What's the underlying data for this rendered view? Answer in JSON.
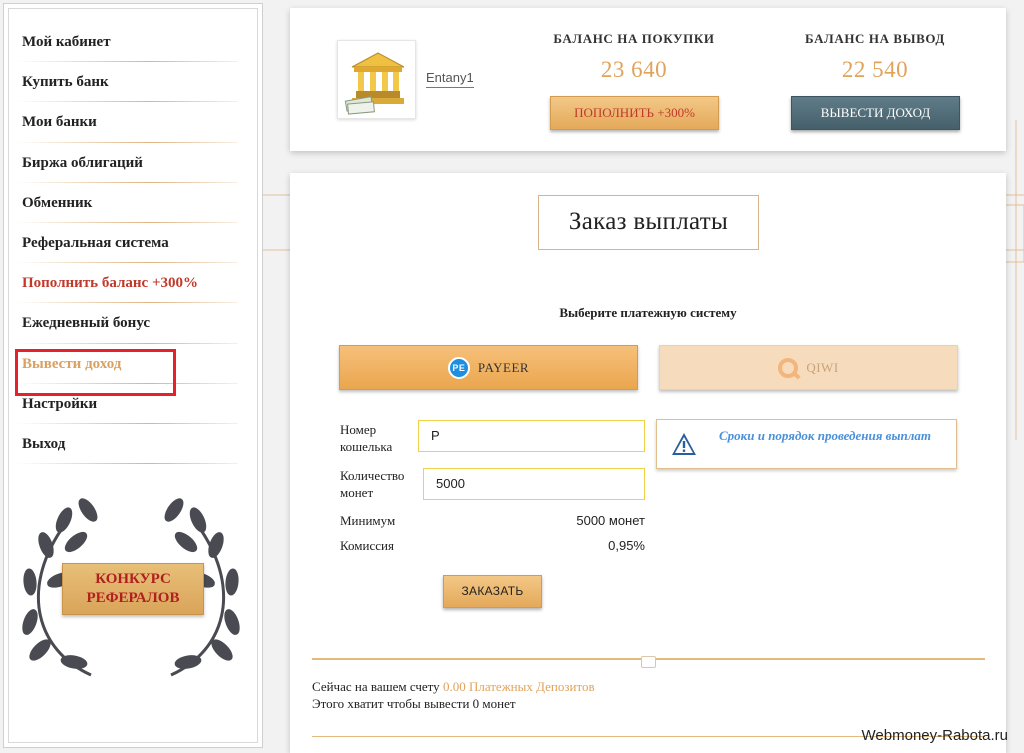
{
  "sidebar": {
    "items": [
      {
        "label": "Мой кабинет"
      },
      {
        "label": "Купить банк"
      },
      {
        "label": "Мои банки"
      },
      {
        "label": "Биржа облигаций"
      },
      {
        "label": "Обменник"
      },
      {
        "label": "Реферальная система"
      },
      {
        "label": "Пополнить баланс +300%"
      },
      {
        "label": "Ежедневный бонус"
      },
      {
        "label": "Вывести доход"
      },
      {
        "label": "Настройки"
      },
      {
        "label": "Выход"
      }
    ],
    "contest_line1": "КОНКУРС",
    "contest_line2": "РЕФЕРАЛОВ",
    "accent_color": "#c0392b",
    "active_color": "#d9a060",
    "highlight_frame_color": "#e8202a"
  },
  "header": {
    "username": "Entany1",
    "avatar_icon": "bank-building-icon",
    "purchase_balance_title": "БАЛАНС НА ПОКУПКИ",
    "purchase_balance_value": "23 640",
    "withdraw_balance_title": "БАЛАНС НА ВЫВОД",
    "withdraw_balance_value": "22 540",
    "topup_label": "ПОПОЛНИТЬ +300%",
    "withdraw_label": "ВЫВЕСТИ ДОХОД"
  },
  "main": {
    "title": "Заказ выплаты",
    "choose_label": "Выберите платежную систему",
    "payment_systems": [
      {
        "label": "PAYEER",
        "icon": "payeer-icon",
        "selected": true
      },
      {
        "label": "QIWI",
        "icon": "qiwi-icon",
        "selected": false
      }
    ],
    "wallet_label_line1": "Номер",
    "wallet_label_line2": "кошелька",
    "wallet_value": "P",
    "amount_label_line1": "Количество",
    "amount_label_line2": "монет",
    "amount_value": "5000",
    "minimum_label": "Минимум",
    "minimum_value": "5000 монет",
    "commission_label": "Комиссия",
    "commission_value": "0,95%",
    "order_label": "ЗАКАЗАТЬ",
    "terms_text": "Сроки и порядок проведения выплат",
    "account_prefix": "Сейчас на вашем счету",
    "account_highlight": "0.00 Платежных Депозитов",
    "account_line2": "Этого хватит чтобы вывести 0 монет"
  },
  "watermark": "Webmoney-Rabota.ru"
}
